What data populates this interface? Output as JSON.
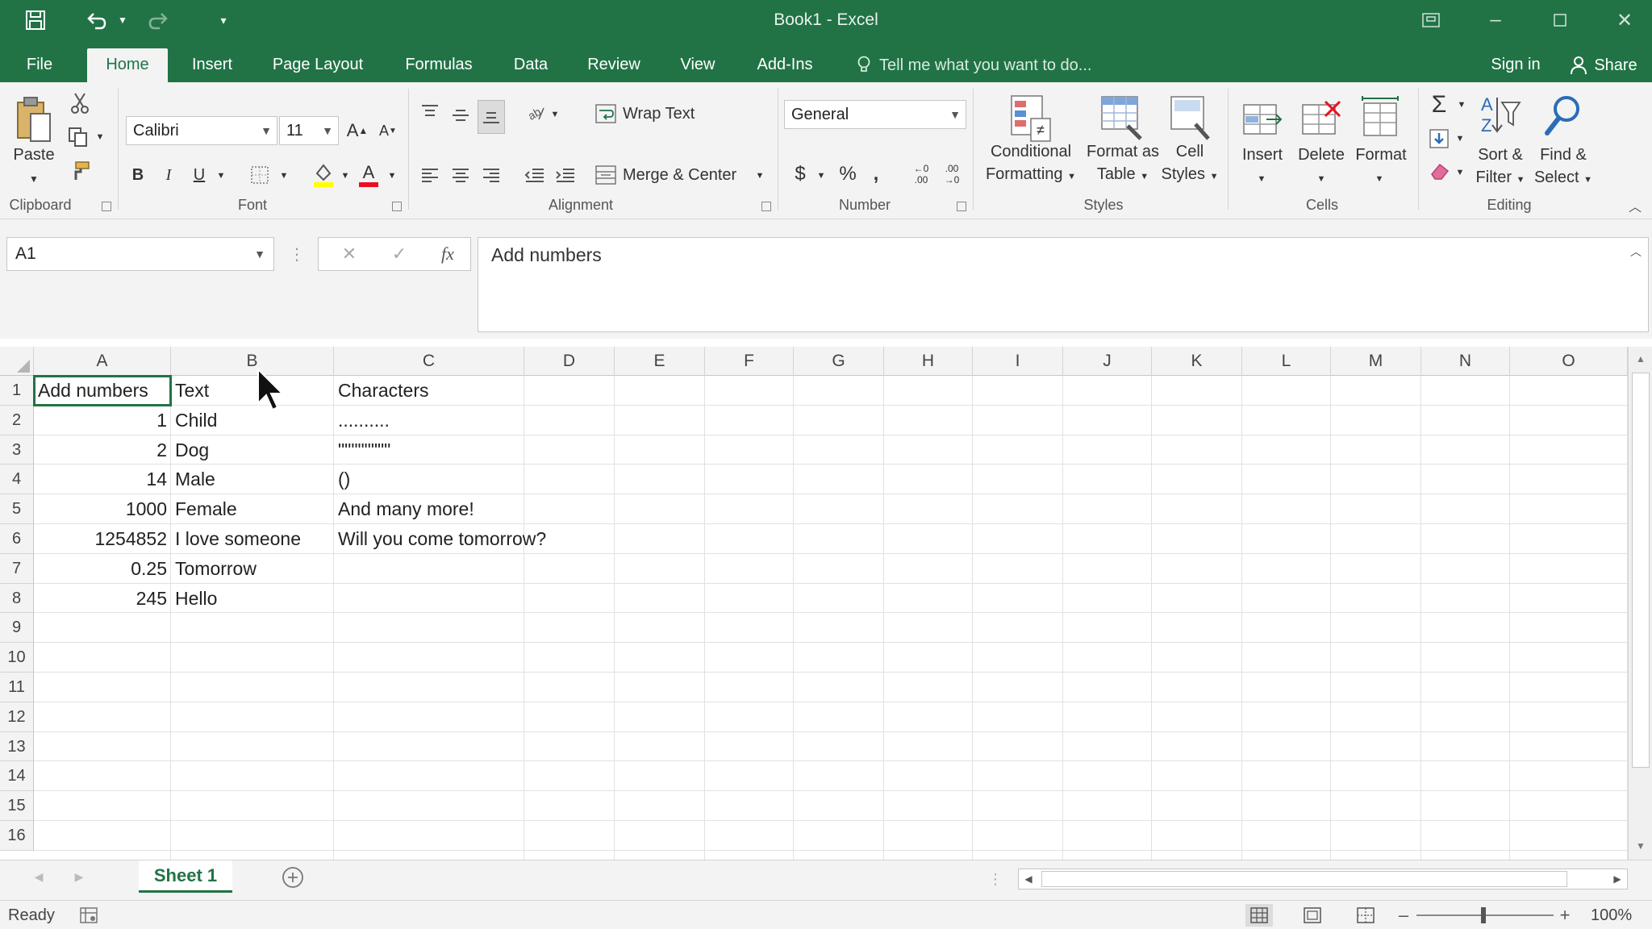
{
  "title": "Book1 - Excel",
  "tabs": [
    "File",
    "Home",
    "Insert",
    "Page Layout",
    "Formulas",
    "Data",
    "Review",
    "View",
    "Add-Ins"
  ],
  "active_tab": "Home",
  "tell_me": "Tell me what you want to do...",
  "sign_in": "Sign in",
  "share": "Share",
  "ribbon": {
    "clipboard": {
      "label": "Clipboard",
      "paste": "Paste"
    },
    "font": {
      "label": "Font",
      "name": "Calibri",
      "size": "11",
      "bold": "B",
      "italic": "I",
      "underline": "U"
    },
    "alignment": {
      "label": "Alignment",
      "wrap_text": "Wrap Text",
      "merge_center": "Merge & Center"
    },
    "number": {
      "label": "Number",
      "format": "General",
      "currency": "$",
      "percent": "%",
      "comma": ",",
      "inc_decimal": "←0 .00",
      "dec_decimal": ".00 →0"
    },
    "styles": {
      "label": "Styles",
      "conditional": [
        "Conditional",
        "Formatting"
      ],
      "format_table": [
        "Format as",
        "Table"
      ],
      "cell_styles": [
        "Cell",
        "Styles"
      ]
    },
    "cells": {
      "label": "Cells",
      "insert": "Insert",
      "delete": "Delete",
      "format": "Format"
    },
    "editing": {
      "label": "Editing",
      "sort_filter": [
        "Sort &",
        "Filter"
      ],
      "find_select": [
        "Find &",
        "Select"
      ]
    }
  },
  "name_box": "A1",
  "formula": "Add numbers",
  "columns": [
    "A",
    "B",
    "C",
    "D",
    "E",
    "F",
    "G",
    "H",
    "I",
    "J",
    "K",
    "L",
    "M",
    "N",
    "O"
  ],
  "rows": [
    "1",
    "2",
    "3",
    "4",
    "5",
    "6",
    "7",
    "8",
    "9",
    "10",
    "11",
    "12",
    "13",
    "14",
    "15",
    "16"
  ],
  "cells": {
    "A": [
      "Add numbers",
      "1",
      "2",
      "14",
      "1000",
      "1254852",
      "0.25",
      "245"
    ],
    "B": [
      "Text",
      "Child",
      "Dog",
      "Male",
      "Female",
      "I love someone",
      "Tomorrow",
      "Hello"
    ],
    "C": [
      "Characters",
      "..........",
      "\"\"\"\"\"\"\"\"",
      "()",
      "And many more!",
      "Will you come tomorrow?"
    ]
  },
  "sheet_tab": "Sheet 1",
  "status": "Ready",
  "zoom": "100%",
  "colors": {
    "excel_green": "#217346",
    "ribbon_bg": "#f3f3f3"
  }
}
